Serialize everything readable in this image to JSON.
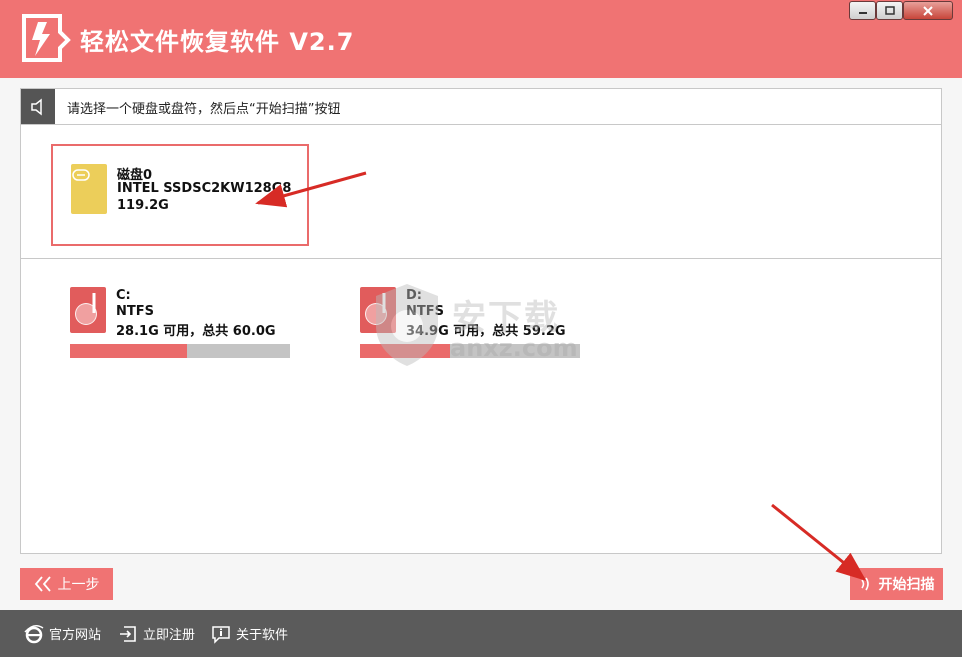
{
  "app": {
    "title": "轻松文件恢复软件 V2.7"
  },
  "window_controls": {
    "minimize": "minimize",
    "maximize": "maximize",
    "close": "close"
  },
  "hint": {
    "text": "请选择一个硬盘或盘符，然后点“开始扫描”按钮"
  },
  "disk": {
    "name": "磁盘0",
    "model": "INTEL SSDSC2KW128G8",
    "size": "119.2G"
  },
  "partitions": [
    {
      "letter": "C:",
      "fs": "NTFS",
      "usage": "28.1G 可用，总共 60.0G",
      "used_fraction": 0.53
    },
    {
      "letter": "D:",
      "fs": "NTFS",
      "usage": "34.9G 可用，总共 59.2G",
      "used_fraction": 0.41
    }
  ],
  "buttons": {
    "back": "上一步",
    "scan": "开始扫描"
  },
  "footer": {
    "site": "官方网站",
    "register": "立即注册",
    "about": "关于软件"
  },
  "watermark": {
    "cn": "安下载",
    "en": "anxz.com"
  },
  "colors": {
    "accent": "#f07373",
    "footer_bg": "#5b5b5b",
    "disk_icon": "#ecce5a",
    "partition_icon": "#e15c5c"
  }
}
